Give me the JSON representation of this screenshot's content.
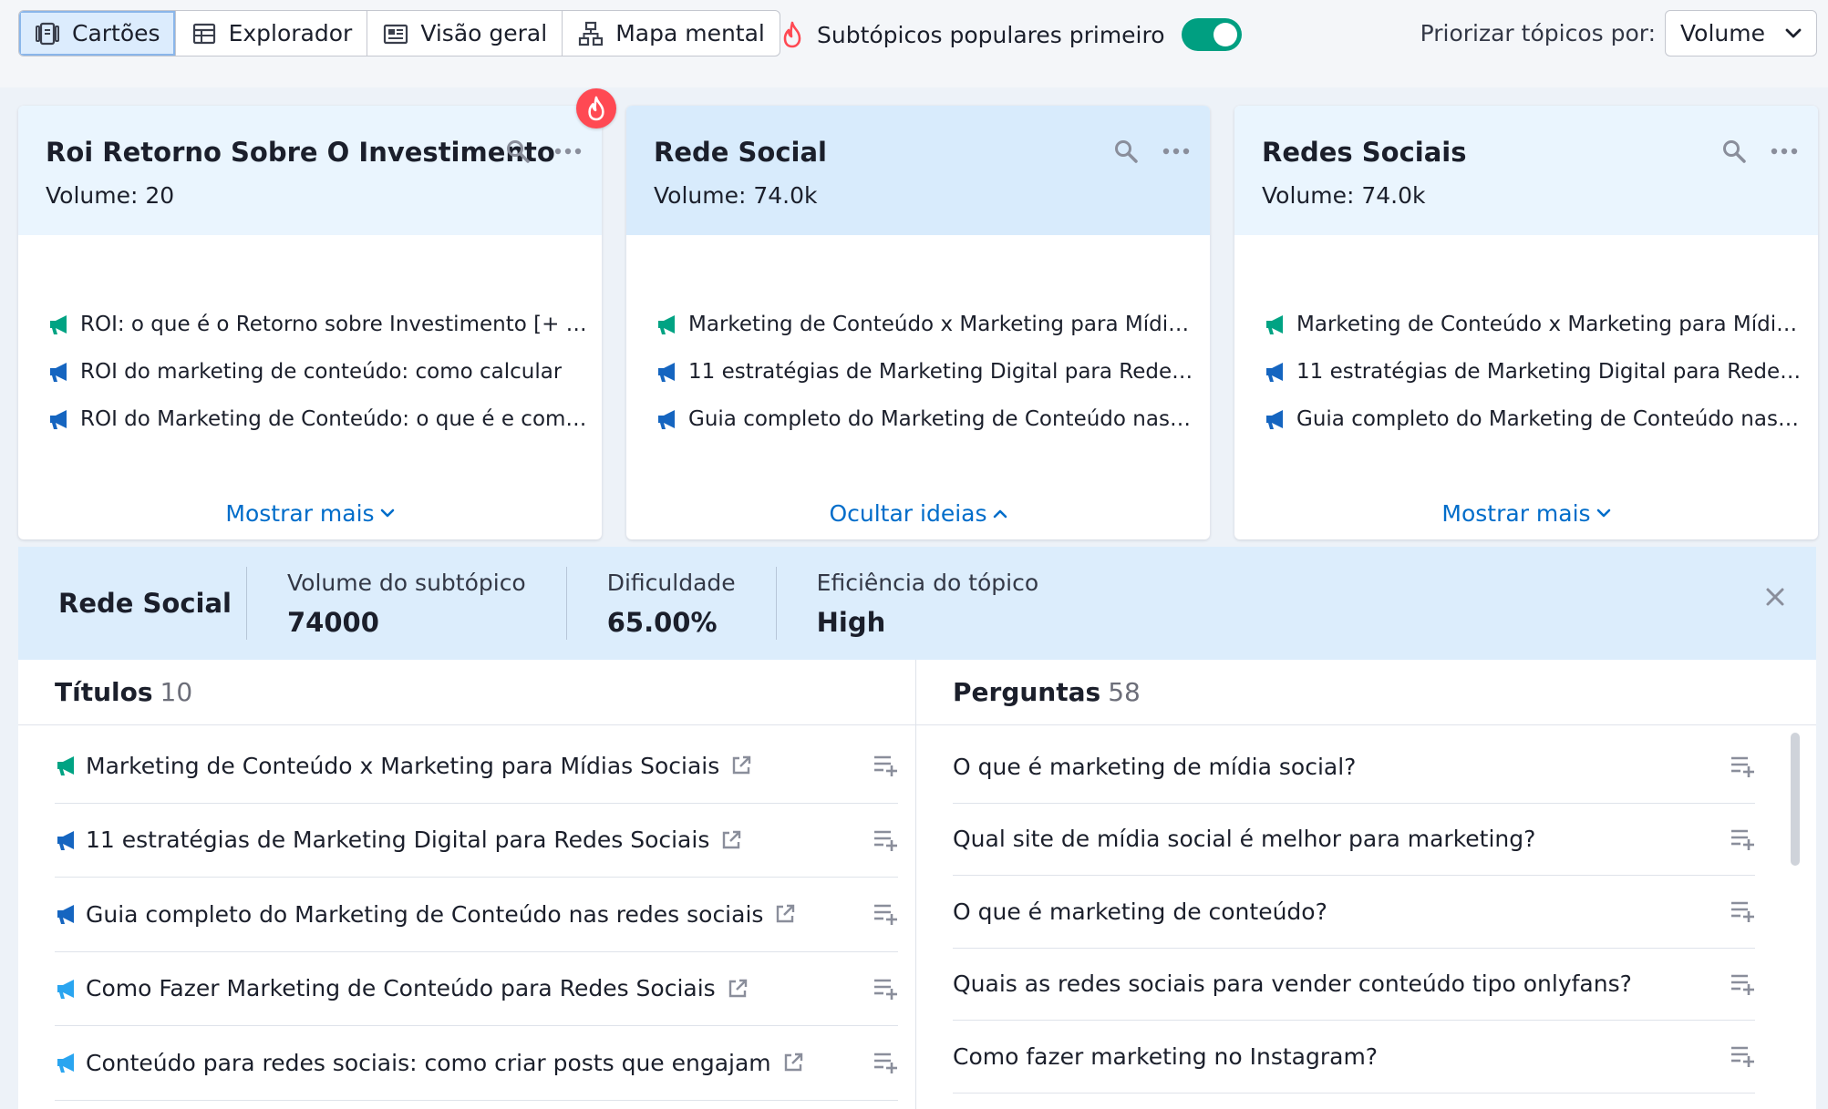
{
  "toolbar": {
    "tabs": [
      {
        "label": "Cartões",
        "icon": "cards-icon",
        "active": true
      },
      {
        "label": "Explorador",
        "icon": "table-icon",
        "active": false
      },
      {
        "label": "Visão geral",
        "icon": "overview-icon",
        "active": false
      },
      {
        "label": "Mapa mental",
        "icon": "mindmap-icon",
        "active": false
      }
    ],
    "popular_label": "Subtópicos populares primeiro",
    "popular_enabled": true,
    "prioritize_label": "Priorizar tópicos por:",
    "prioritize_value": "Volume"
  },
  "cards": [
    {
      "title": "Roi Retorno Sobre O Investimento",
      "volume": "Volume: 20",
      "items": [
        {
          "text": "ROI: o que é o Retorno sobre Investimento [+ …",
          "icon": "megaphone-green"
        },
        {
          "text": "ROI do marketing de conteúdo: como calcular",
          "icon": "megaphone-blue"
        },
        {
          "text": "ROI do Marketing de Conteúdo: o que é e com…",
          "icon": "megaphone-blue"
        }
      ],
      "footer": "Mostrar mais",
      "expanded": false,
      "trending": true
    },
    {
      "title": "Rede Social",
      "volume": "Volume: 74.0k",
      "items": [
        {
          "text": "Marketing de Conteúdo x Marketing para Mídi…",
          "icon": "megaphone-green"
        },
        {
          "text": "11 estratégias de Marketing Digital para Redes…",
          "icon": "megaphone-blue"
        },
        {
          "text": "Guia completo do Marketing de Conteúdo nas …",
          "icon": "megaphone-blue"
        }
      ],
      "footer": "Ocultar ideias",
      "expanded": true,
      "trending": false
    },
    {
      "title": "Redes Sociais",
      "volume": "Volume: 74.0k",
      "items": [
        {
          "text": "Marketing de Conteúdo x Marketing para Mídi…",
          "icon": "megaphone-green"
        },
        {
          "text": "11 estratégias de Marketing Digital para Redes…",
          "icon": "megaphone-blue"
        },
        {
          "text": "Guia completo do Marketing de Conteúdo nas …",
          "icon": "megaphone-blue"
        }
      ],
      "footer": "Mostrar mais",
      "expanded": false,
      "trending": false
    }
  ],
  "detail": {
    "title": "Rede Social",
    "stats": [
      {
        "label": "Volume do subtópico",
        "value": "74000"
      },
      {
        "label": "Dificuldade",
        "value": "65.00%"
      },
      {
        "label": "Eficiência do tópico",
        "value": "High"
      }
    ],
    "titles": {
      "label": "Títulos",
      "count": "10",
      "rows": [
        {
          "text": "Marketing de Conteúdo x Marketing para Mídias Sociais",
          "icon": "megaphone-green"
        },
        {
          "text": "11 estratégias de Marketing Digital para Redes Sociais",
          "icon": "megaphone-blue"
        },
        {
          "text": "Guia completo do Marketing de Conteúdo nas redes sociais",
          "icon": "megaphone-blue"
        },
        {
          "text": "Como Fazer Marketing de Conteúdo para Redes Sociais",
          "icon": "megaphone-lightblue"
        },
        {
          "text": "Conteúdo para redes sociais: como criar posts que engajam",
          "icon": "megaphone-lightblue"
        }
      ]
    },
    "questions": {
      "label": "Perguntas",
      "count": "58",
      "rows": [
        {
          "text": "O que é marketing de mídia social?"
        },
        {
          "text": "Qual site de mídia social é melhor para marketing?"
        },
        {
          "text": "O que é marketing de conteúdo?"
        },
        {
          "text": "Quais as redes sociais para vender conteúdo tipo onlyfans?"
        },
        {
          "text": "Como fazer marketing no Instagram?"
        }
      ]
    }
  },
  "colors": {
    "accent": "#006dca",
    "toggle_on": "#009f81",
    "megaphone_green": "#00a383",
    "megaphone_blue": "#1565c0",
    "megaphone_lightblue": "#2aa5f0",
    "trending_badge": "#ff4953"
  }
}
